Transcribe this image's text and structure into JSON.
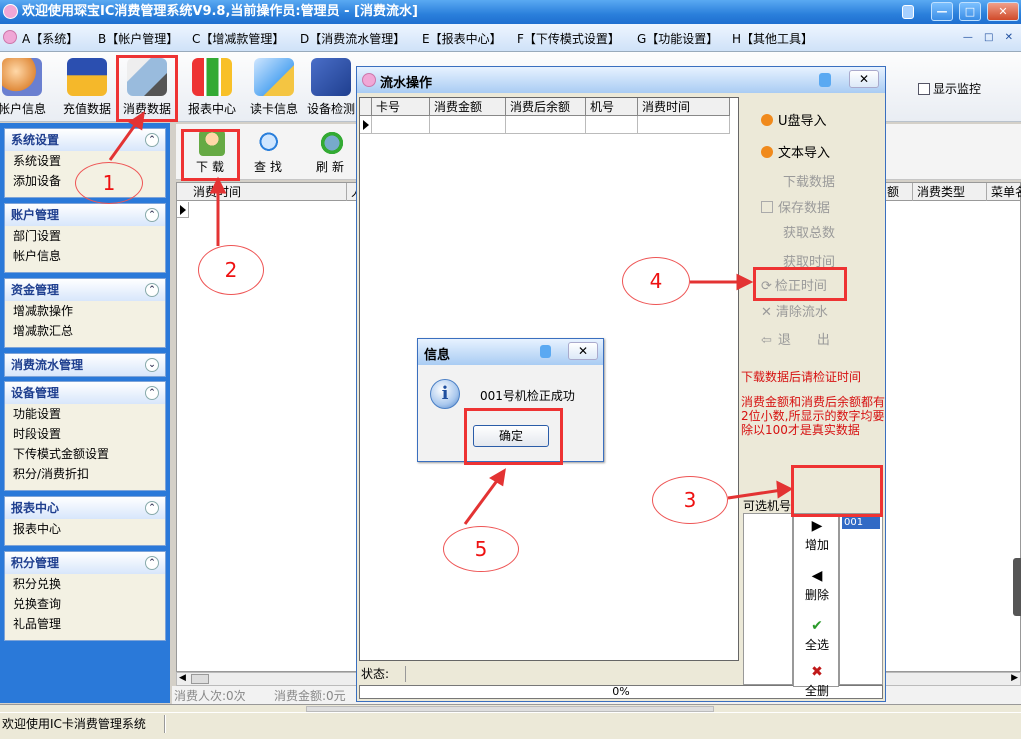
{
  "window": {
    "title": "欢迎使用琛宝IC消费管理系统V9.8,当前操作员:管理员 - [消费流水]",
    "minimize_label": "—",
    "maximize_label": "□",
    "close_label": "✕"
  },
  "menu": {
    "items": [
      "A【系统】",
      "B【帐户管理】",
      "C【增减款管理】",
      "D【消费流水管理】",
      "E【报表中心】",
      "F【下传模式设置】",
      "G【功能设置】",
      "H【其他工具】"
    ],
    "mdi_controls": "— □ ✕"
  },
  "toolbar": {
    "buttons": [
      "帐户信息",
      "充值数据",
      "消费数据",
      "报表中心",
      "读卡信息",
      "设备检测"
    ],
    "show_monitor_label": "显示监控"
  },
  "sidebar": {
    "panels": [
      {
        "title": "系统设置",
        "toggle": "⌃",
        "items": [
          "系统设置",
          "添加设备"
        ]
      },
      {
        "title": "账户管理",
        "toggle": "⌃",
        "items": [
          "部门设置",
          "帐户信息"
        ]
      },
      {
        "title": "资金管理",
        "toggle": "⌃",
        "items": [
          "增减款操作",
          "增减款汇总"
        ]
      },
      {
        "title": "消费流水管理",
        "toggle": "⌄",
        "items": []
      },
      {
        "title": "设备管理",
        "toggle": "⌃",
        "items": [
          "功能设置",
          "时段设置",
          "下传模式金额设置",
          "积分/消费折扣"
        ]
      },
      {
        "title": "报表中心",
        "toggle": "⌃",
        "items": [
          "报表中心"
        ]
      },
      {
        "title": "积分管理",
        "toggle": "⌃",
        "items": [
          "积分兑换",
          "兑换查询",
          "礼品管理"
        ]
      }
    ]
  },
  "subtoolbar": {
    "buttons": [
      "下载",
      "查找",
      "刷新"
    ]
  },
  "main_grid": {
    "headers": [
      "消费时间",
      "人",
      "额",
      "消费类型",
      "菜单名"
    ]
  },
  "main_status": {
    "count_label": "消费人次:0次",
    "amount_label": "消费金额:0元"
  },
  "bottom_status": {
    "text": "欢迎使用IC卡消费管理系统"
  },
  "flow_dialog": {
    "title": "流水操作",
    "close_label": "✕",
    "grid_headers": [
      "卡号",
      "消费金额",
      "消费后余额",
      "机号",
      "消费时间"
    ],
    "status_label": "状态:",
    "progress_text": "0%",
    "side_buttons": [
      {
        "label": "U盘导入",
        "enabled": true
      },
      {
        "label": "文本导入",
        "enabled": true
      },
      {
        "label": "下载数据",
        "enabled": false
      },
      {
        "label": "保存数据",
        "enabled": false
      },
      {
        "label": "获取总数",
        "enabled": false
      },
      {
        "label": "获取时间",
        "enabled": false
      },
      {
        "label": "检正时间",
        "enabled": false
      },
      {
        "label": "清除流水",
        "enabled": false
      },
      {
        "label": "退　　出",
        "enabled": false
      }
    ],
    "note_1": "下载数据后请检证时间",
    "note_2": "消费金额和消费后余额都有2位小数,所显示的数字均要除以100才是真实数据",
    "machine_label": "可选机号",
    "machine_buttons": [
      {
        "glyph": "▶",
        "label": "增加"
      },
      {
        "glyph": "◀",
        "label": "删除"
      },
      {
        "glyph": "✔",
        "label": "全选"
      },
      {
        "glyph": "✖",
        "label": "全删"
      }
    ],
    "selected_machines": [
      "001"
    ]
  },
  "info_dialog": {
    "title": "信息",
    "close_label": "✕",
    "icon_glyph": "i",
    "message": "001号机检正成功",
    "ok_label": "确定"
  },
  "annotations": {
    "labels": [
      "1",
      "2",
      "3",
      "4",
      "5"
    ],
    "accent_color": "#e33333"
  }
}
